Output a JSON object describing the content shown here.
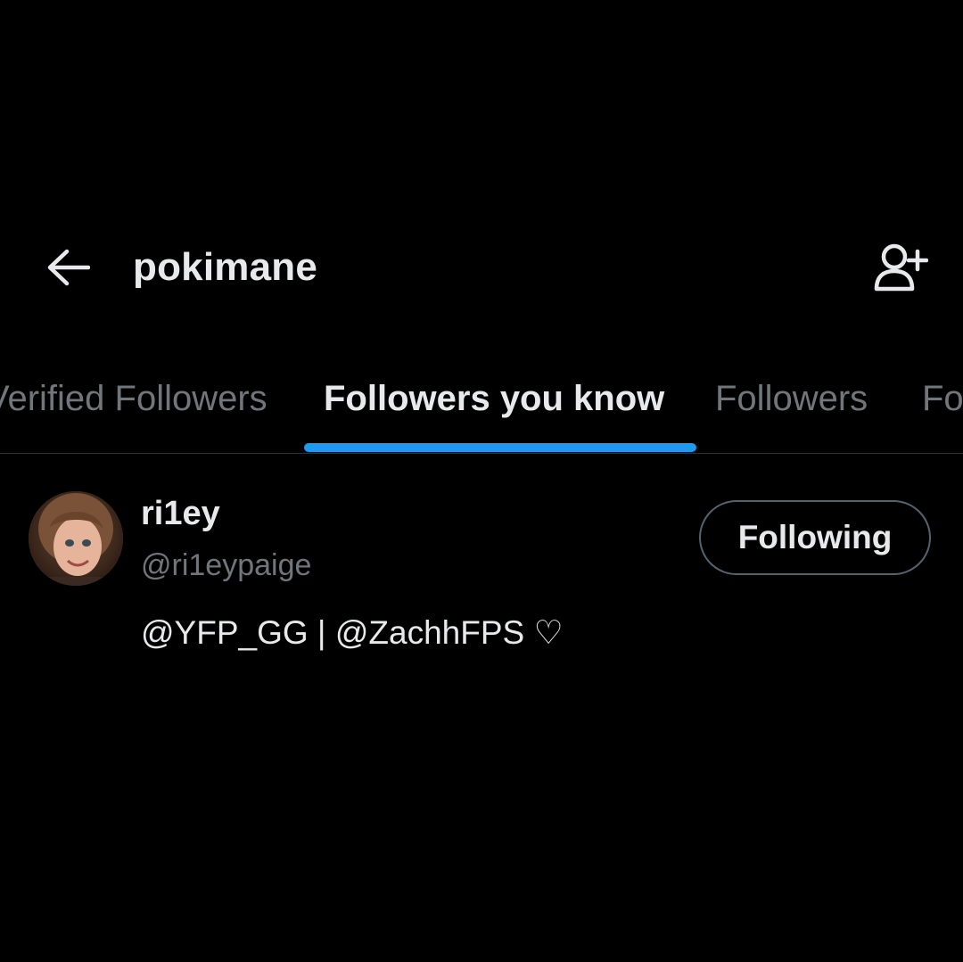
{
  "header": {
    "title": "pokimane",
    "back_icon": "arrow-left-icon",
    "add_user_icon": "person-add-icon"
  },
  "tabs": [
    {
      "label": "Verified Followers",
      "active": false
    },
    {
      "label": "Followers you know",
      "active": true
    },
    {
      "label": "Followers",
      "active": false
    },
    {
      "label": "Following",
      "active": false
    }
  ],
  "users": [
    {
      "display_name": "ri1ey",
      "handle": "@ri1eypaige",
      "bio": "@YFP_GG | @ZachhFPS ♡",
      "follow_button_label": "Following"
    }
  ],
  "colors": {
    "background": "#000000",
    "primary_text": "#e7e9ea",
    "secondary_text": "#71767b",
    "accent": "#1d9bf0",
    "border": "#536471"
  }
}
